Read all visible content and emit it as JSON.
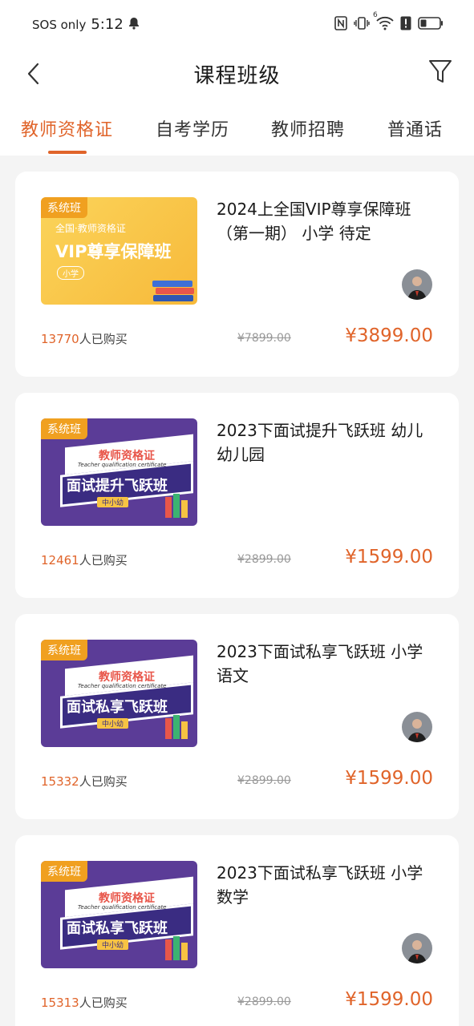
{
  "status_bar": {
    "carrier": "SOS only",
    "time": "5:12",
    "signal_mark": "6"
  },
  "header": {
    "title": "课程班级",
    "back_icon": "chevron-left-icon",
    "filter_icon": "funnel-icon"
  },
  "tabs": [
    {
      "label": "教师资格证",
      "active": true
    },
    {
      "label": "自考学历",
      "active": false
    },
    {
      "label": "教师招聘",
      "active": false
    },
    {
      "label": "普通话",
      "active": false
    }
  ],
  "colors": {
    "accent": "#e0642a",
    "card_bg": "#ffffff",
    "page_bg": "#f4f4f4"
  },
  "courses": [
    {
      "badge": "系统班",
      "thumb": {
        "top": "全国·教师资格证",
        "main": "VIP尊享保障班",
        "sub": "小学"
      },
      "title": "2024上全国VIP尊享保障班（第一期） 小学 待定",
      "buyers_count": "13770",
      "buyers_suffix": "人已购买",
      "original_price": "¥7899.00",
      "price": "¥3899.00",
      "has_avatar": true
    },
    {
      "badge": "系统班",
      "thumb": {
        "top": "教师资格证",
        "en": "Teacher qualification certificate",
        "main": "面试提升飞跃班",
        "sub": "中小幼"
      },
      "title": "2023下面试提升飞跃班 幼儿 幼儿园",
      "buyers_count": "12461",
      "buyers_suffix": "人已购买",
      "original_price": "¥2899.00",
      "price": "¥1599.00",
      "has_avatar": false
    },
    {
      "badge": "系统班",
      "thumb": {
        "top": "教师资格证",
        "en": "Teacher qualification certificate",
        "main": "面试私享飞跃班",
        "sub": "中小幼"
      },
      "title": "2023下面试私享飞跃班 小学 语文",
      "buyers_count": "15332",
      "buyers_suffix": "人已购买",
      "original_price": "¥2899.00",
      "price": "¥1599.00",
      "has_avatar": true
    },
    {
      "badge": "系统班",
      "thumb": {
        "top": "教师资格证",
        "en": "Teacher qualification certificate",
        "main": "面试私享飞跃班",
        "sub": "中小幼"
      },
      "title": "2023下面试私享飞跃班 小学 数学",
      "buyers_count": "15313",
      "buyers_suffix": "人已购买",
      "original_price": "¥2899.00",
      "price": "¥1599.00",
      "has_avatar": true
    }
  ]
}
